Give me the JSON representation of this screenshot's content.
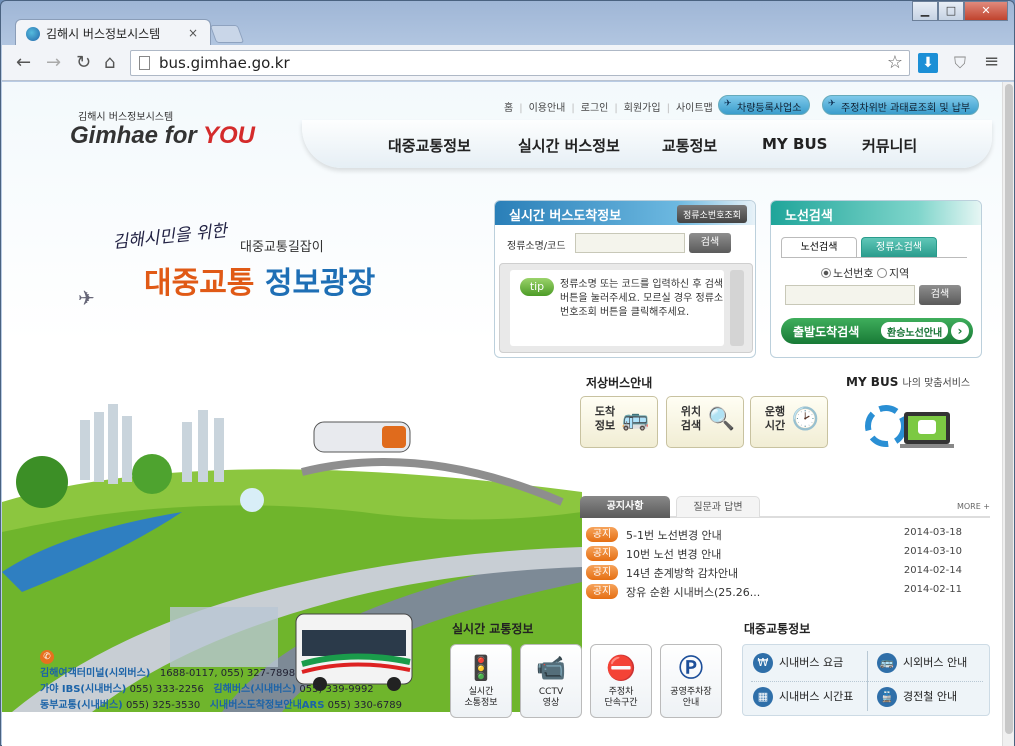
{
  "browser": {
    "tab_title": "김해시 버스정보시스템",
    "tab_close": "×",
    "url": "bus.gimhae.go.kr",
    "win_min": "▁",
    "win_max": "□",
    "win_close": "✕"
  },
  "header": {
    "logo_sub": "김해시 버스정보시스템",
    "logo_main": "Gimhae for ",
    "logo_you": "YOU",
    "top_links": [
      "홈",
      "이용안내",
      "로그인",
      "회원가입",
      "사이트맵"
    ],
    "pill1": "차량등록사업소",
    "pill2": "주정차위반 과태료조회 및 납부",
    "nav": [
      "대중교통정보",
      "실시간 버스정보",
      "교통정보",
      "MY BUS",
      "커뮤니티"
    ]
  },
  "hero": {
    "line1": "김해시민을 위한",
    "line2": "대중교통길잡이",
    "line3a": "대중교통",
    "line3b": "정보광장"
  },
  "arrival_panel": {
    "title": "실시간 버스도착정보",
    "lookup_button": "정류소번호조회",
    "field_label": "정류소명/코드",
    "search_button": "검색",
    "tip_badge": "tip",
    "tip_text": "정류소명 또는 코드를 입력하신 후 검색버튼을 눌러주세요. 모르실 경우 정류소번호조회 버튼을 클릭해주세요."
  },
  "route_panel": {
    "title": "노선검색",
    "tab_route": "노선검색",
    "tab_stop": "정류소검색",
    "radio1": "노선번호",
    "radio2": "지역",
    "search_button": "검색",
    "od_label": "출발도착검색",
    "od_sub": "환승노선안내",
    "od_arrow": "›"
  },
  "lowfloor": {
    "title": "저상버스안내",
    "tiles": [
      {
        "label": "도착\n정보",
        "icon": "bus-front-icon"
      },
      {
        "label": "위치\n검색",
        "icon": "magnifier-icon"
      },
      {
        "label": "운행\n시간",
        "icon": "clock-icon"
      }
    ]
  },
  "mybus": {
    "title": "MY BUS",
    "subtitle": "나의 맞춤서비스"
  },
  "notice": {
    "tab_notice": "공지사항",
    "tab_qa": "질문과 답변",
    "more": "MORE +",
    "badge": "공지",
    "items": [
      {
        "text": "5-1번 노선변경 안내",
        "date": "2014-03-18"
      },
      {
        "text": "10번 노선 변경 안내",
        "date": "2014-03-10"
      },
      {
        "text": "14년 춘계방학 감차안내",
        "date": "2014-02-14"
      },
      {
        "text": "장유 순환 시내버스(25.26...",
        "date": "2014-02-11"
      }
    ]
  },
  "traffic": {
    "title": "실시간 교통정보",
    "items": [
      {
        "label": "실시간\n소통정보",
        "icon": "traffic-light-icon"
      },
      {
        "label": "CCTV\n영상",
        "icon": "cctv-icon"
      },
      {
        "label": "주정차\n단속구간",
        "icon": "no-parking-icon"
      },
      {
        "label": "공영주차장\n안내",
        "icon": "parking-icon"
      }
    ]
  },
  "public_transit": {
    "title": "대중교통정보",
    "items": [
      "시내버스 요금",
      "시외버스 안내",
      "시내버스 시간표",
      "경전철 안내"
    ]
  },
  "contact": {
    "rows": [
      {
        "name": "김해여객터미널(시외버스)",
        "phone": "1688-0117, 055) 327-7898"
      },
      {
        "name": "가야 IBS(시내버스)",
        "phone": "055) 333-2256",
        "name2": "김해버스(시내버스)",
        "phone2": "055) 339-9992"
      },
      {
        "name": "동부교통(시내버스)",
        "phone": "055) 325-3530",
        "name2": "시내버스도착정보안내ARS",
        "phone2": "055) 330-6789"
      }
    ]
  },
  "colors": {
    "accent_blue": "#2a7fb8",
    "accent_green": "#187a36",
    "notice_orange": "#e56f14"
  }
}
